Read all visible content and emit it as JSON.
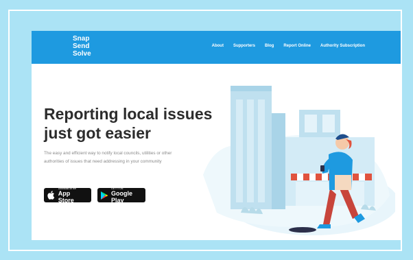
{
  "header": {
    "logo_lines": [
      "Snap",
      "Send",
      "Solve"
    ],
    "nav": [
      "About",
      "Supporters",
      "Blog",
      "Report Online",
      "Authority Subscription"
    ]
  },
  "hero": {
    "headline_line1": "Reporting local issues",
    "headline_line2": "just got easier",
    "subtitle": "The easy and efficient way to notify local councils, utilities or other authorities of issues that need addressing in your community"
  },
  "badges": {
    "appstore_small": "Download on the",
    "appstore_big": "App Store",
    "gplay_small": "GET IT ON",
    "gplay_big": "Google Play"
  },
  "colors": {
    "background": "#abe3f5",
    "header": "#1e9ae0",
    "headline": "#2c2c2c",
    "accent_red": "#e0533e"
  },
  "icons": [
    "apple-icon",
    "google-play-icon"
  ]
}
